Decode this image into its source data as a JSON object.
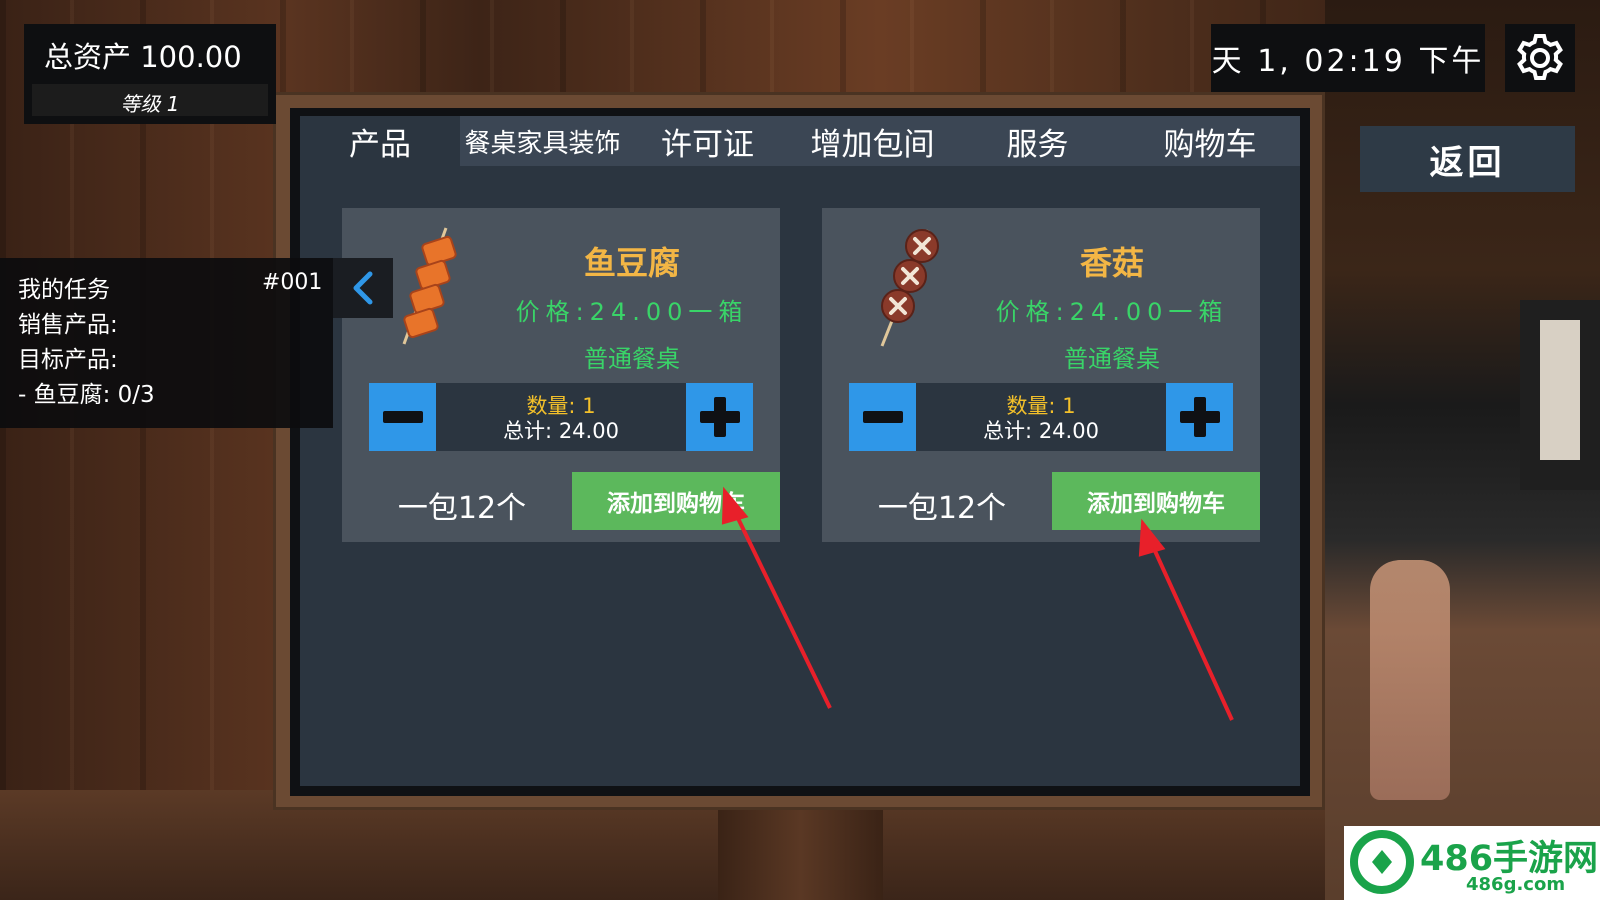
{
  "hud": {
    "assets_label": "总资产 100.00",
    "level_label": "等级 1",
    "time": "天 1, 02:19 下午",
    "back_label": "返回"
  },
  "tabs": [
    {
      "label": "产品",
      "active": true
    },
    {
      "label": "餐桌家具装饰",
      "active": false
    },
    {
      "label": "许可证",
      "active": false
    },
    {
      "label": "增加包间",
      "active": false
    },
    {
      "label": "服务",
      "active": false
    },
    {
      "label": "购物车",
      "active": false
    }
  ],
  "products": [
    {
      "name": "鱼豆腐",
      "price": "价格:24.00一箱",
      "type": "普通餐桌",
      "quantity": "数量: 1",
      "total": "总计: 24.00",
      "pack": "一包12个",
      "add_label": "添加到购物车",
      "icon": "fish-tofu-skewer-icon"
    },
    {
      "name": "香菇",
      "price": "价格:24.00一箱",
      "type": "普通餐桌",
      "quantity": "数量: 1",
      "total": "总计: 24.00",
      "pack": "一包12个",
      "add_label": "添加到购物车",
      "icon": "mushroom-skewer-icon"
    }
  ],
  "tasks": {
    "title": "我的任务",
    "id": "#001",
    "line1": "销售产品:",
    "line2": "目标产品:",
    "line3": "- 鱼豆腐: 0/3"
  },
  "watermark": {
    "brand": "486手游网",
    "domain": "486g.com"
  },
  "colors": {
    "accent_blue": "#2f97e8",
    "add_green": "#5cb85c",
    "title_gold": "#f3b645",
    "price_green": "#39d468",
    "annotation_red": "#e8202a"
  }
}
